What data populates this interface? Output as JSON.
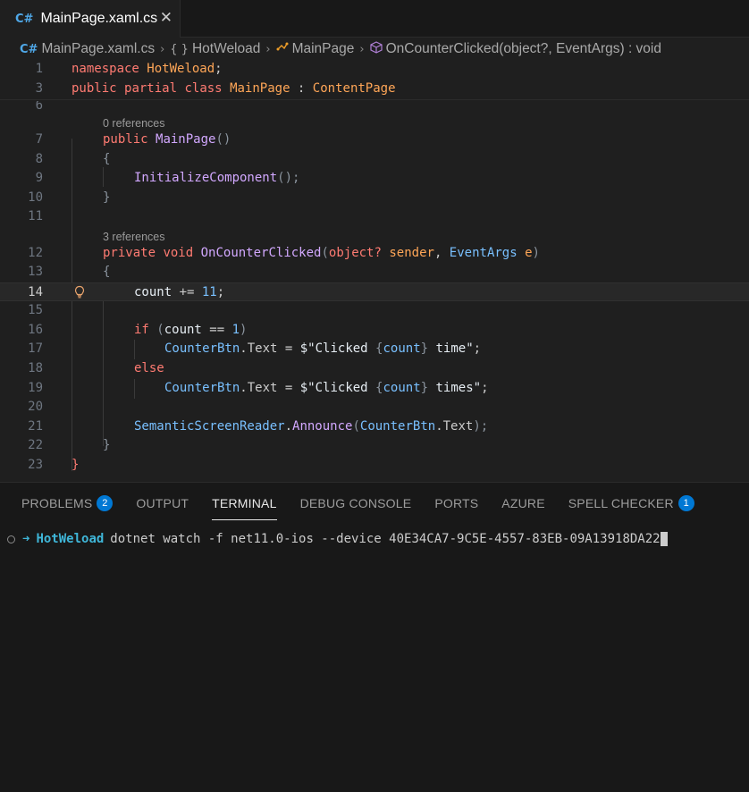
{
  "tab": {
    "icon": "C#",
    "label": "MainPage.xaml.cs",
    "close": "✕"
  },
  "breadcrumb": {
    "file": "MainPage.xaml.cs",
    "namespace": "HotWeload",
    "class": "MainPage",
    "method": "OnCounterClicked(object?, EventArgs) : void"
  },
  "editor": {
    "line_numbers": [
      "1",
      "3",
      "6",
      "7",
      "8",
      "9",
      "10",
      "11",
      "12",
      "13",
      "14",
      "15",
      "16",
      "17",
      "18",
      "19",
      "20",
      "21",
      "22",
      "23"
    ],
    "active_line": "14",
    "codelens": [
      "0 references",
      "3 references"
    ],
    "code": {
      "l1": [
        "namespace",
        " ",
        "HotWeload",
        ";"
      ],
      "l3": [
        "public",
        " ",
        "partial",
        " ",
        "class",
        " ",
        "MainPage",
        " : ",
        "ContentPage"
      ],
      "l7": [
        "public",
        " ",
        "MainPage",
        "()"
      ],
      "l8": "{",
      "l9": [
        "InitializeComponent",
        "();"
      ],
      "l10": "}",
      "l12": [
        "private",
        " ",
        "void",
        " ",
        "OnCounterClicked",
        "(",
        "object?",
        " ",
        "sender",
        ", ",
        "EventArgs",
        " ",
        "e",
        ")"
      ],
      "l13": "{",
      "l14": [
        "count",
        " += ",
        "11",
        ";"
      ],
      "l16": [
        "if",
        " (",
        "count",
        " == ",
        "1",
        ")"
      ],
      "l17": [
        "CounterBtn",
        ".",
        "Text",
        " = ",
        "$\"Clicked ",
        "{",
        "count",
        "}",
        " time\"",
        ";"
      ],
      "l18": "else",
      "l19": [
        "CounterBtn",
        ".",
        "Text",
        " = ",
        "$\"Clicked ",
        "{",
        "count",
        "}",
        " times\"",
        ";"
      ],
      "l21": [
        "SemanticScreenReader",
        ".",
        "Announce",
        "(",
        "CounterBtn",
        ".",
        "Text",
        ");"
      ],
      "l22": "}",
      "l23": "}"
    }
  },
  "panel": {
    "tabs": [
      {
        "label": "PROBLEMS",
        "badge": "2"
      },
      {
        "label": "OUTPUT"
      },
      {
        "label": "TERMINAL"
      },
      {
        "label": "DEBUG CONSOLE"
      },
      {
        "label": "PORTS"
      },
      {
        "label": "AZURE"
      },
      {
        "label": "SPELL CHECKER",
        "badge": "1"
      }
    ],
    "active_tab": "TERMINAL",
    "terminal": {
      "prompt_arrow": "➜",
      "cwd": "HotWeload",
      "command": "dotnet watch -f net11.0-ios --device 40E34CA7-9C5E-4557-83EB-09A13918DA22"
    }
  },
  "colors": {
    "accent": "#0078d4",
    "keyword": "#ff7b72",
    "type": "#ffa657",
    "function": "#d2a8ff"
  }
}
